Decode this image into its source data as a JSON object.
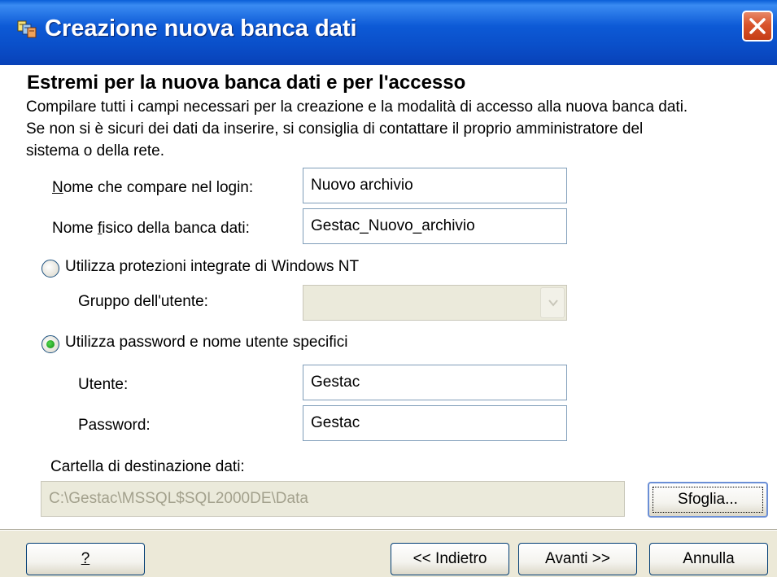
{
  "window": {
    "title": "Creazione nuova banca dati"
  },
  "page": {
    "heading": "Estremi per la nuova banca dati e per l'accesso",
    "description": "Compilare tutti i campi necessari per la creazione e la modalità di accesso alla nuova banca dati. Se non si è sicuri dei dati da inserire, si consiglia di contattare il proprio amministratore del sistema o della rete."
  },
  "form": {
    "login_name_label": "Nome che compare nel login:",
    "login_name_value": "Nuovo archivio",
    "physical_name_label": "Nome fisico della banca dati:",
    "physical_name_value": "Gestac_Nuovo_archivio",
    "radio_windows_nt_label": "Utilizza protezioni integrate di Windows NT",
    "radio_windows_nt_selected": false,
    "user_group_label": "Gruppo dell'utente:",
    "user_group_value": "",
    "radio_password_label": "Utilizza password e nome utente specifici",
    "radio_password_selected": true,
    "user_label": "Utente:",
    "user_value": "Gestac",
    "password_label": "Password:",
    "password_value": "Gestac",
    "dest_folder_label": "Cartella di destinazione dati:",
    "dest_folder_value": "C:\\Gestac\\MSSQL$SQL2000DE\\Data",
    "browse_button": "Sfoglia..."
  },
  "footer": {
    "help_button": "?",
    "back_button": "<< Indietro",
    "next_button": "Avanti >>",
    "cancel_button": "Annulla"
  },
  "colors": {
    "titlebar": "#0a4fc9",
    "dialog_bg": "#ece9d8",
    "close_button": "#d8542c",
    "radio_selected": "#21a121"
  },
  "icons": {
    "app": "database-wizard-icon",
    "close": "close-icon",
    "dropdown": "chevron-down-icon"
  }
}
